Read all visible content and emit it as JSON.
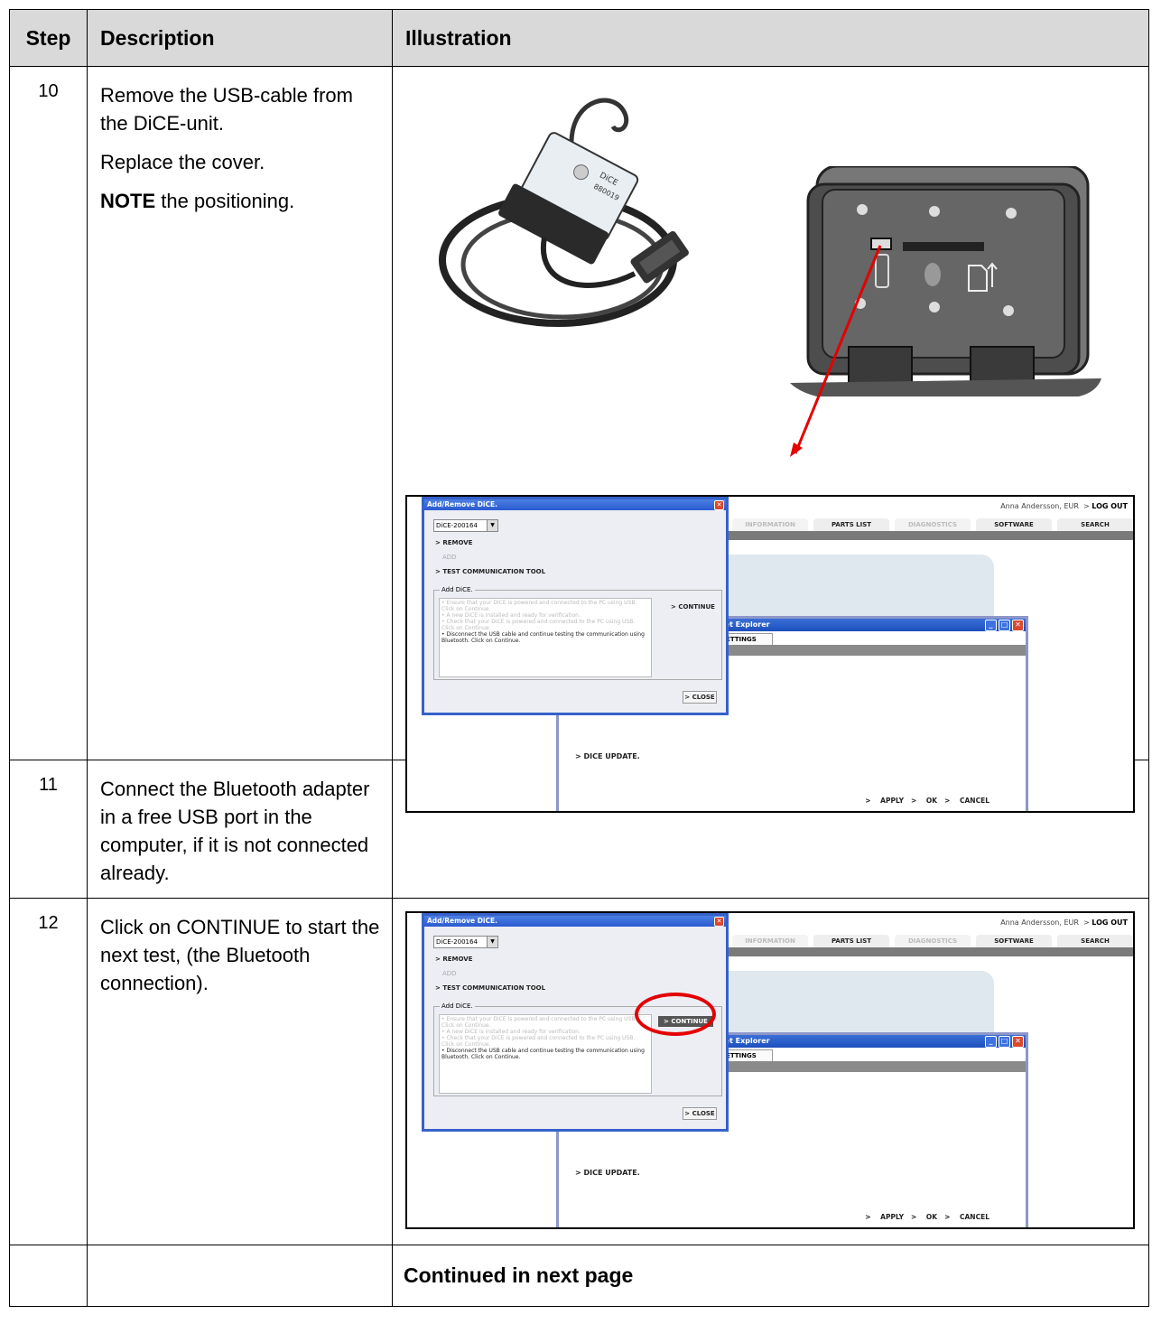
{
  "headers": {
    "step": "Step",
    "description": "Description",
    "illustration": "Illustration"
  },
  "rows": [
    {
      "step": "10",
      "paragraphs": [
        "Remove the USB-cable from the DiCE-unit.",
        "Replace the cover."
      ],
      "note_bold": "NOTE",
      "note_rest": " the positioning."
    },
    {
      "step": "11",
      "paragraphs": [
        "Connect the Bluetooth adapter in a free USB port in the computer, if it is not connected already."
      ]
    },
    {
      "step": "12",
      "paragraphs": [
        "Click on CONTINUE to start the next test, (the Bluetooth connection)."
      ]
    }
  ],
  "footer": {
    "text": "Continued in next page"
  },
  "screenshot": {
    "user": "Anna Andersson, EUR",
    "logout": "LOG OUT",
    "tabs": [
      "INFORMATION",
      "PARTS LIST",
      "DIAGNOSTICS",
      "SOFTWARE",
      "SEARCH"
    ],
    "ie_title": "rnet Explorer",
    "ie_tab": "SETTINGS",
    "dice_update": "DICE UPDATE.",
    "ie_dots": "...",
    "apply": "APPLY",
    "ok": "OK",
    "cancel": "CANCEL",
    "dialog_title": "Add/Remove DiCE.",
    "dice_select": "DiCE-200164",
    "remove": "REMOVE",
    "add": "ADD",
    "test_tool": "TEST COMMUNICATION TOOL",
    "group_label": "Add DiCE.",
    "list_dim": [
      "• Ensure that your DiCE is powered and connected to the PC using USB. Click on Continue.",
      "• A new DiCE is installed and ready for verification.",
      "• Check that your DiCE is powered and connected to the PC using USB. Click on Continue."
    ],
    "list_active": "• Disconnect the USB cable and continue testing the communication using Bluetooth. Click on Continue.",
    "continue": "CONTINUE",
    "close": "CLOSE"
  },
  "device": {
    "label1": "DiCE",
    "label2": "880019"
  }
}
